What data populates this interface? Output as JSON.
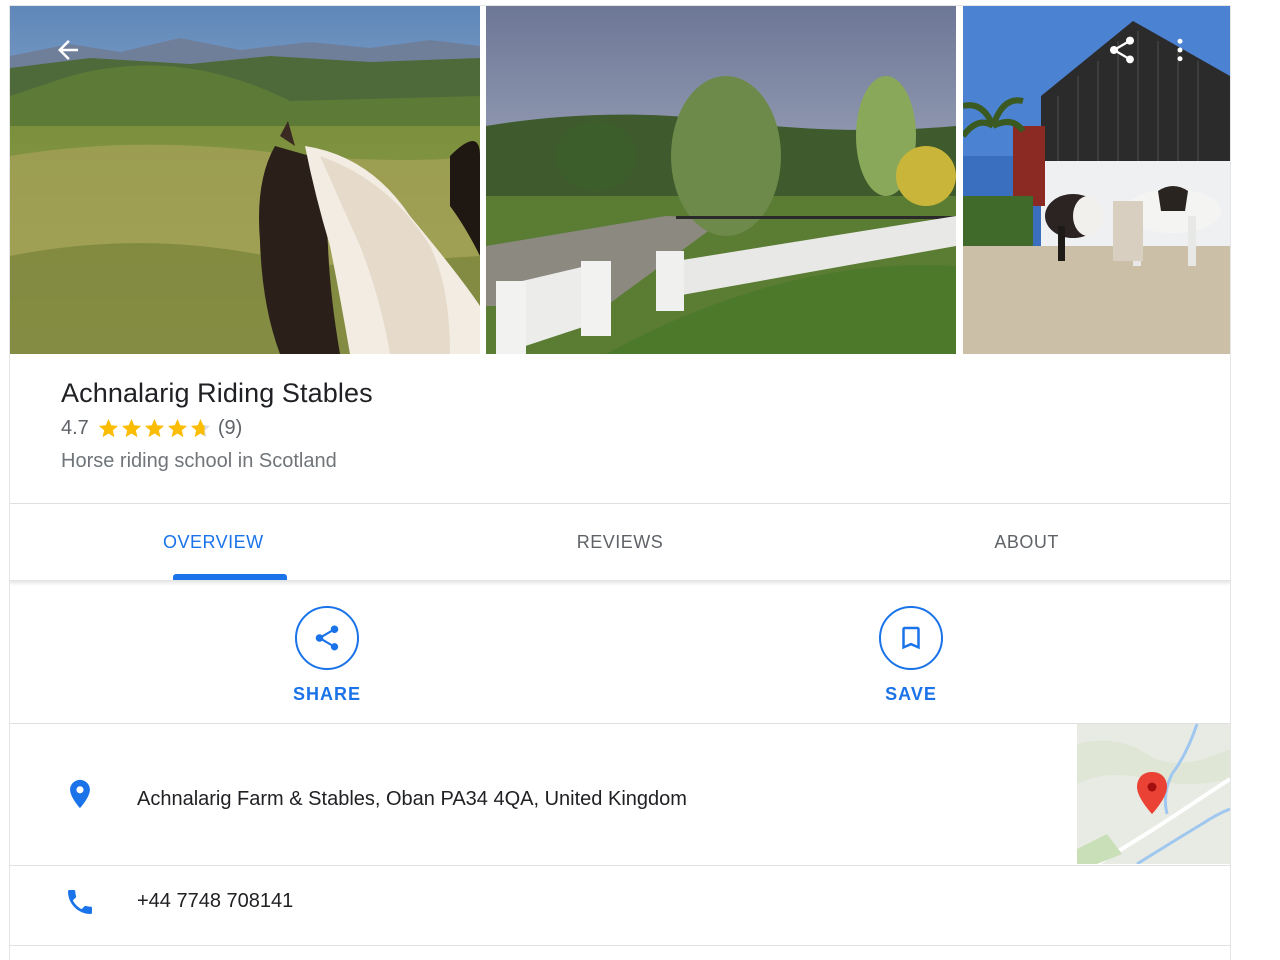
{
  "place": {
    "name": "Achnalarig Riding Stables",
    "rating": "4.7",
    "rating_value": 4.7,
    "review_count": "(9)",
    "category": "Horse riding school in Scotland"
  },
  "photos": [
    {
      "subject": "horse-mane-hills"
    },
    {
      "subject": "gate-and-garden"
    },
    {
      "subject": "horses-at-barn"
    }
  ],
  "header_icons": {
    "back": "arrow-left-icon",
    "share": "share-icon",
    "more": "more-vert-icon"
  },
  "tabs": [
    {
      "label": "OVERVIEW",
      "active": true
    },
    {
      "label": "REVIEWS",
      "active": false
    },
    {
      "label": "ABOUT",
      "active": false
    }
  ],
  "actions": {
    "share_label": "SHARE",
    "save_label": "SAVE"
  },
  "details": {
    "address": "Achnalarig Farm & Stables, Oban PA34 4QA, United Kingdom",
    "phone": "+44 7748 708141"
  },
  "colors": {
    "accent": "#1a73e8",
    "star": "#fbbc04",
    "pin": "#ea4335"
  }
}
